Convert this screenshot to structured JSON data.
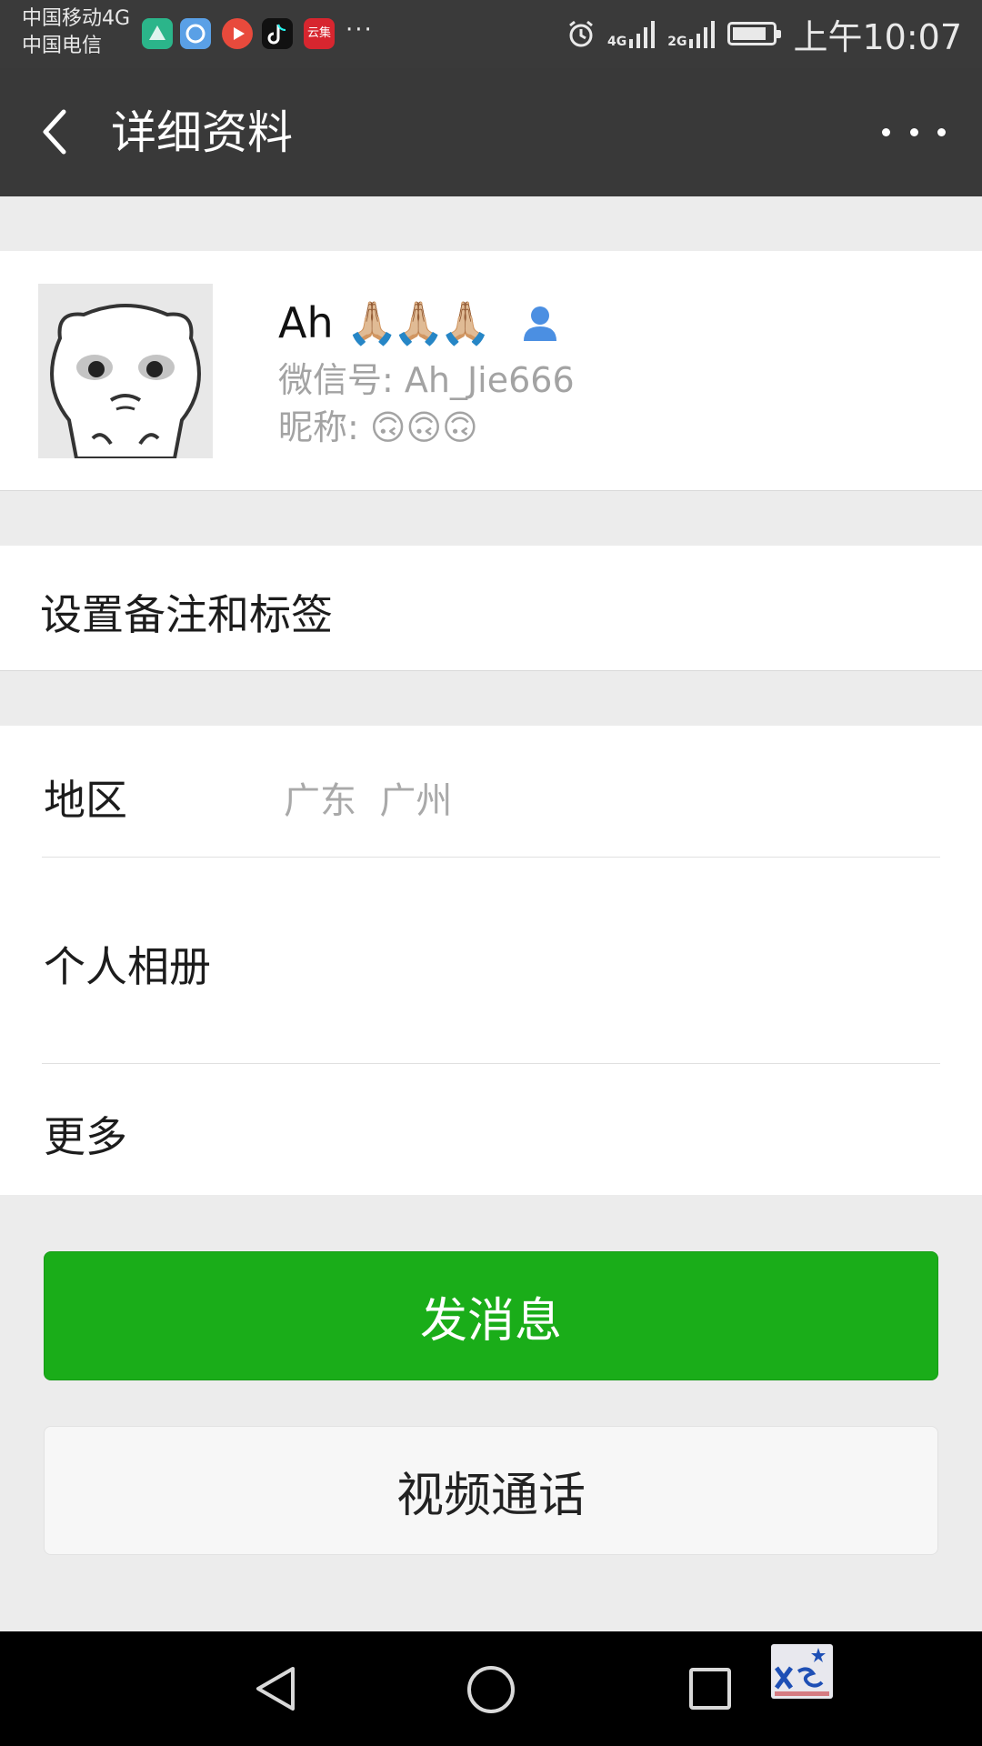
{
  "status_bar": {
    "carrier_1": "中国移动4G",
    "carrier_2": "中国电信",
    "app_icons": [
      "maps-app-icon",
      "browser-app-icon",
      "video-app-icon",
      "tiktok-app-icon",
      "yunji-app-icon"
    ],
    "app_icon_colors": [
      "#2bb58a",
      "#5aa0e6",
      "#e84a3c",
      "#111111",
      "#d7262f"
    ],
    "yunji_label": "云集",
    "more_dots": "···",
    "net_4g": "4G",
    "net_2g": "2G",
    "time": "上午10:07",
    "battery_level": 0.85
  },
  "header": {
    "title": "详细资料"
  },
  "profile": {
    "name": "Ah",
    "name_emoji": "🙏🏼🙏🏼🙏🏼",
    "wechat_id_label": "微信号: ",
    "wechat_id": "Ah_Jie666",
    "nickname_label": "昵称: ",
    "nickname": "🙃🙃🙃"
  },
  "rows": {
    "remark_label": "设置备注和标签",
    "region_label": "地区",
    "region_value": "广东  广州",
    "album_label": "个人相册",
    "more_label": "更多"
  },
  "buttons": {
    "message": "发消息",
    "video_call": "视频通话"
  },
  "colors": {
    "header_bg": "#393939",
    "accent_green": "#1aad19",
    "page_bg": "#ececec"
  }
}
